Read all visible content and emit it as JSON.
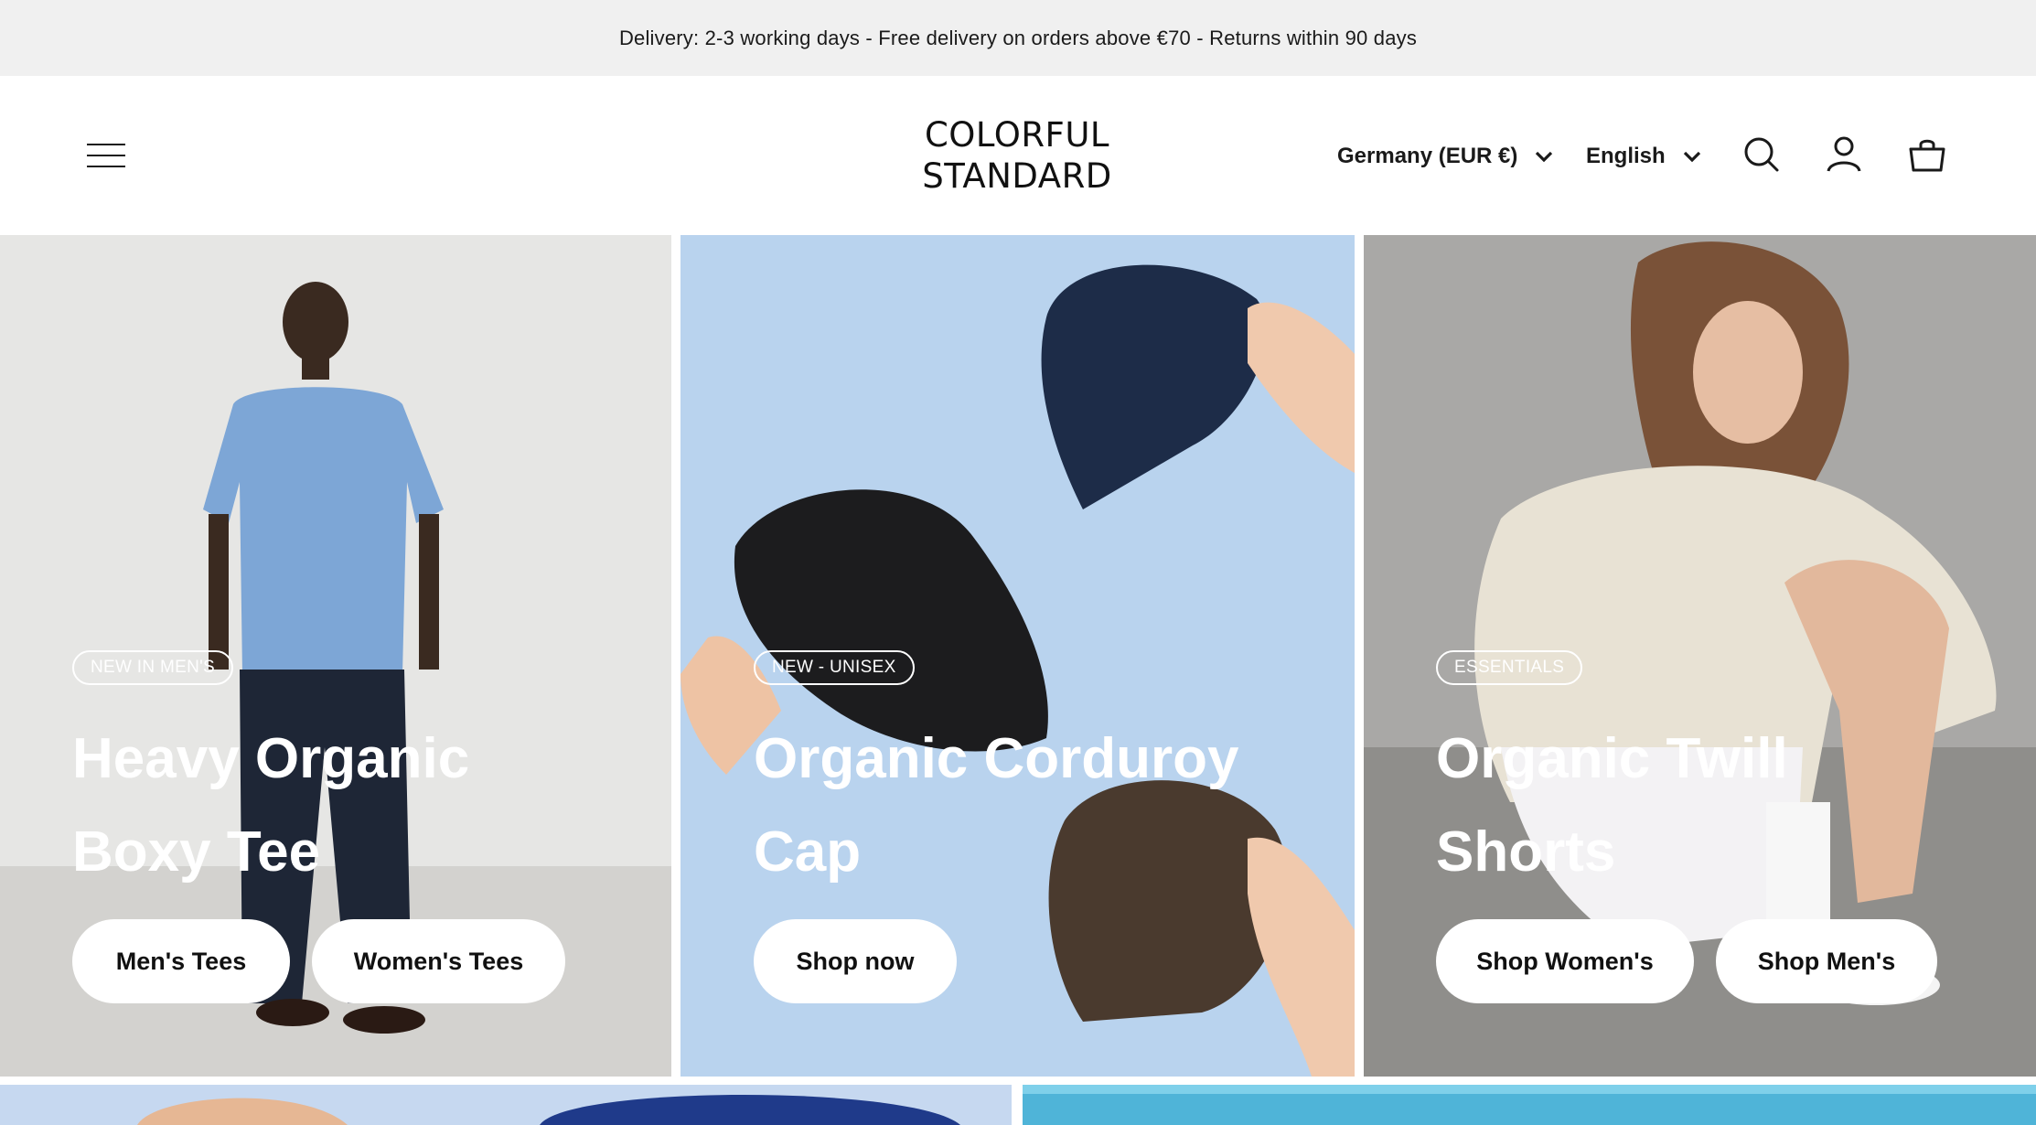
{
  "announcement": "Delivery: 2-3 working days - Free delivery on orders above €70 - Returns within 90 days",
  "header": {
    "logo_line1": "COLORFUL",
    "logo_line2": "STANDARD",
    "country_selector": "Germany (EUR €)",
    "language_selector": "English",
    "icons": [
      "menu-icon",
      "search-icon",
      "account-icon",
      "cart-icon"
    ]
  },
  "panels": [
    {
      "tag": "NEW IN MEN'S",
      "title_line1": "Heavy Organic",
      "title_line2": "Boxy Tee",
      "buttons": [
        "Men's Tees",
        "Women's Tees"
      ],
      "background_color": "#e4e4e2"
    },
    {
      "tag": "NEW - UNISEX",
      "title_line1": "Organic Corduroy",
      "title_line2": "Cap",
      "buttons": [
        "Shop now"
      ],
      "background_color": "#b9d3ee"
    },
    {
      "tag": "ESSENTIALS",
      "title_line1": "Organic Twill",
      "title_line2": "Shorts",
      "buttons": [
        "Shop Women's",
        "Shop Men's"
      ],
      "background_color": "#a9a8a6"
    }
  ],
  "colors": {
    "announcement_bg": "#f0f0f0",
    "text": "#111111",
    "button_bg": "#ffffff"
  }
}
